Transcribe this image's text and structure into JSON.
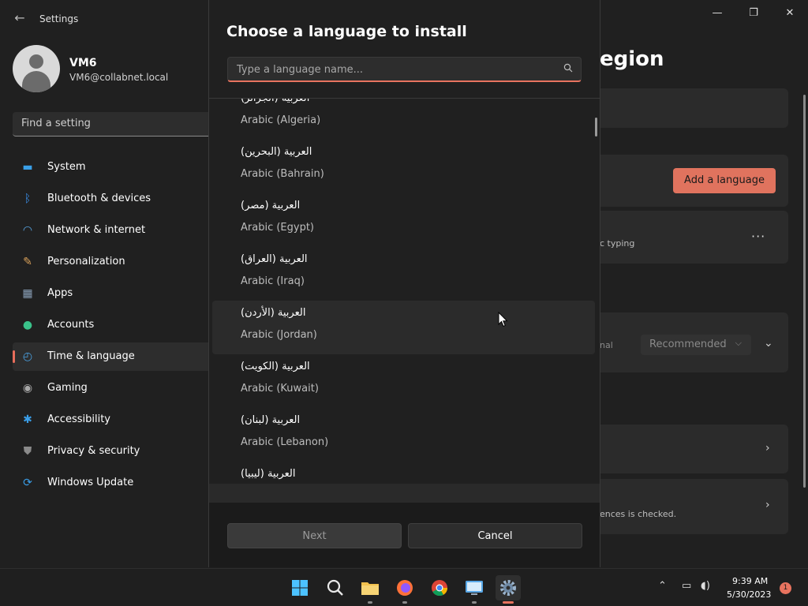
{
  "window": {
    "app_title": "Settings",
    "minimize": "—",
    "maximize": "❐",
    "close": "✕",
    "back": "←"
  },
  "profile": {
    "name": "VM6",
    "email": "VM6@collabnet.local"
  },
  "search": {
    "placeholder": "Find a setting"
  },
  "sidebar": {
    "items": [
      {
        "label": "System",
        "icon": "monitor-icon",
        "glyph": "▬",
        "color": "#3aa0e8"
      },
      {
        "label": "Bluetooth & devices",
        "icon": "bluetooth-icon",
        "glyph": "ᛒ",
        "color": "#3a8ee8"
      },
      {
        "label": "Network & internet",
        "icon": "wifi-icon",
        "glyph": "◠",
        "color": "#5aa9e8"
      },
      {
        "label": "Personalization",
        "icon": "brush-icon",
        "glyph": "✎",
        "color": "#d9a15a"
      },
      {
        "label": "Apps",
        "icon": "apps-icon",
        "glyph": "▦",
        "color": "#8aa0b8"
      },
      {
        "label": "Accounts",
        "icon": "person-icon",
        "glyph": "●",
        "color": "#3ac28a"
      },
      {
        "label": "Time & language",
        "icon": "globe-clock-icon",
        "glyph": "◴",
        "color": "#4aa0e0"
      },
      {
        "label": "Gaming",
        "icon": "gamepad-icon",
        "glyph": "◉",
        "color": "#a8a8a8"
      },
      {
        "label": "Accessibility",
        "icon": "accessibility-icon",
        "glyph": "✱",
        "color": "#3a9ee8"
      },
      {
        "label": "Privacy & security",
        "icon": "shield-icon",
        "glyph": "⛊",
        "color": "#8a8a8a"
      },
      {
        "label": "Windows Update",
        "icon": "update-icon",
        "glyph": "⟳",
        "color": "#3a9ee8"
      }
    ],
    "active_index": 6
  },
  "content": {
    "title_fragment": "egion",
    "add_language": "Add a language",
    "typing_fragment": "c typing",
    "more": "···",
    "optional_fragment": "nal",
    "recommended": "Recommended",
    "checked_fragment": "ences is checked."
  },
  "dialog": {
    "title": "Choose a language to install",
    "search_placeholder": "Type a language name...",
    "languages": [
      {
        "native": "العربية (الجزائر)",
        "english": "Arabic (Algeria)"
      },
      {
        "native": "العربية (البحرين)",
        "english": "Arabic (Bahrain)"
      },
      {
        "native": "العربية (مصر)",
        "english": "Arabic (Egypt)"
      },
      {
        "native": "العربية (العراق)",
        "english": "Arabic (Iraq)"
      },
      {
        "native": "العربية (الأردن)",
        "english": "Arabic (Jordan)"
      },
      {
        "native": "العربية (الكويت)",
        "english": "Arabic (Kuwait)"
      },
      {
        "native": "العربية (لبنان)",
        "english": "Arabic (Lebanon)"
      },
      {
        "native": "العربية (ليبيا)",
        "english": ""
      }
    ],
    "hover_index": 4,
    "next": "Next",
    "cancel": "Cancel"
  },
  "taskbar": {
    "time": "9:39 AM",
    "date": "5/30/2023",
    "notifications": "1",
    "apps": [
      "start-icon",
      "search-icon",
      "file-explorer-icon",
      "firefox-icon",
      "chrome-icon",
      "remote-desktop-icon",
      "settings-icon"
    ]
  },
  "colors": {
    "accent": "#e8735f",
    "background": "#202020",
    "panel": "#2b2b2b"
  }
}
